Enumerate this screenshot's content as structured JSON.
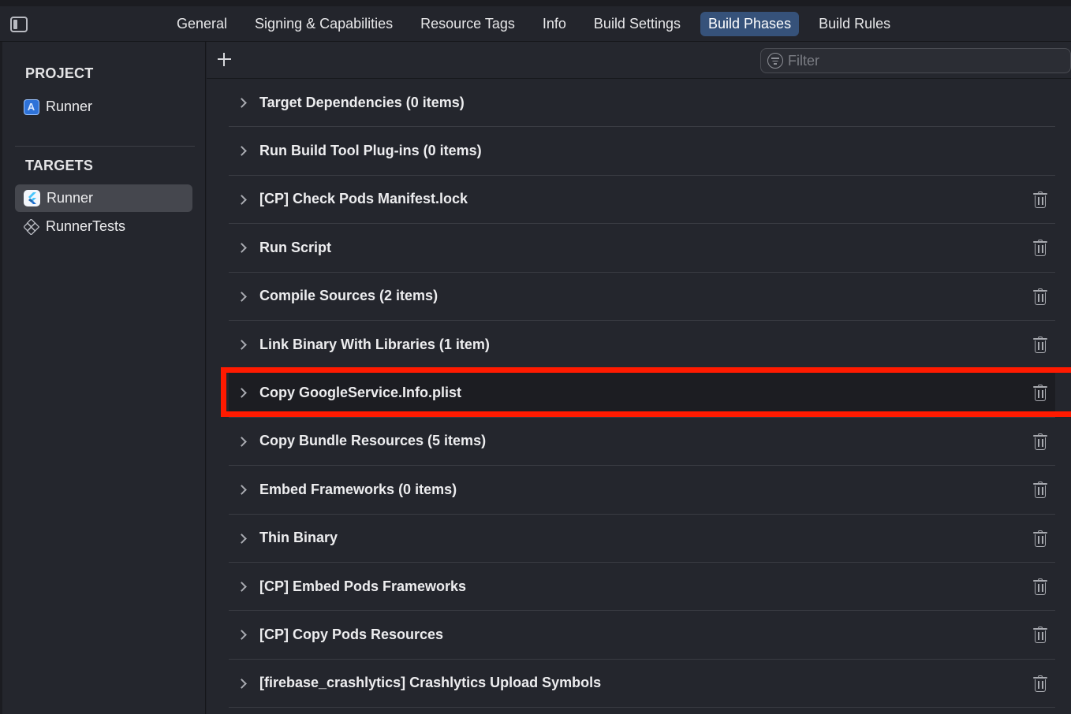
{
  "tabs": [
    {
      "label": "General",
      "active": false
    },
    {
      "label": "Signing & Capabilities",
      "active": false
    },
    {
      "label": "Resource Tags",
      "active": false
    },
    {
      "label": "Info",
      "active": false
    },
    {
      "label": "Build Settings",
      "active": false
    },
    {
      "label": "Build Phases",
      "active": true
    },
    {
      "label": "Build Rules",
      "active": false
    }
  ],
  "sidebar": {
    "project_title": "PROJECT",
    "project_item": {
      "label": "Runner",
      "icon": "xcode-project-icon"
    },
    "targets_title": "TARGETS",
    "targets": [
      {
        "label": "Runner",
        "icon": "flutter-app-icon",
        "selected": true
      },
      {
        "label": "RunnerTests",
        "icon": "test-target-icon",
        "selected": false
      }
    ]
  },
  "toolbar": {
    "add_icon": "plus-icon",
    "filter_placeholder": "Filter",
    "filter_icon": "filter-icon"
  },
  "phases": [
    {
      "label": "Target Dependencies (0 items)",
      "deletable": false
    },
    {
      "label": "Run Build Tool Plug-ins (0 items)",
      "deletable": false
    },
    {
      "label": "[CP] Check Pods Manifest.lock",
      "deletable": true
    },
    {
      "label": "Run Script",
      "deletable": true
    },
    {
      "label": "Compile Sources (2 items)",
      "deletable": true
    },
    {
      "label": "Link Binary With Libraries (1 item)",
      "deletable": true
    },
    {
      "label": "Copy GoogleService.Info.plist",
      "deletable": true,
      "highlighted": true
    },
    {
      "label": "Copy Bundle Resources (5 items)",
      "deletable": true
    },
    {
      "label": "Embed Frameworks (0 items)",
      "deletable": true
    },
    {
      "label": "Thin Binary",
      "deletable": true
    },
    {
      "label": "[CP] Embed Pods Frameworks",
      "deletable": true
    },
    {
      "label": "[CP] Copy Pods Resources",
      "deletable": true
    },
    {
      "label": "[firebase_crashlytics] Crashlytics Upload Symbols",
      "deletable": true
    }
  ],
  "colors": {
    "background": "#24262d",
    "active_tab": "#36527a",
    "selected_row": "#45474e",
    "highlight": "#ff1a00"
  }
}
